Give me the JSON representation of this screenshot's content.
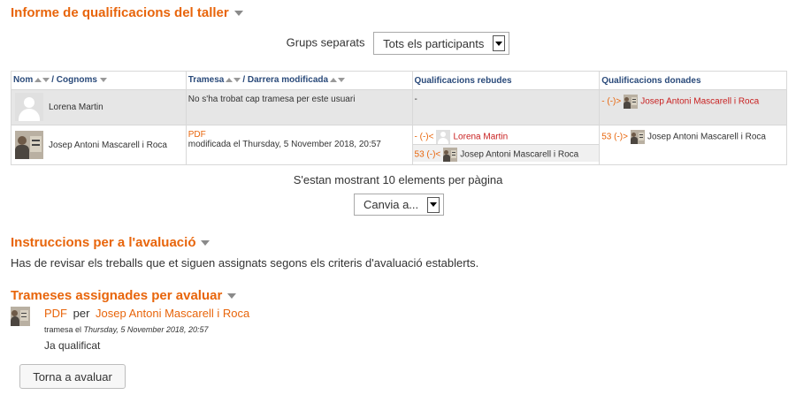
{
  "report": {
    "title": "Informe de qualificacions del taller"
  },
  "groups": {
    "label": "Grups separats",
    "selected": "Tots els participants"
  },
  "table": {
    "headers": {
      "name": "Nom",
      "surname": "/ Cognoms",
      "submission": "Tramesa",
      "last_modified": "/ Darrera modificada",
      "received": "Qualificacions rebudes",
      "given": "Qualificacions donades"
    },
    "rows": [
      {
        "user": "Lorena Martin",
        "avatar": "default-user-icon",
        "submission_text": "No s'ha trobat cap tramesa per este usuari",
        "received": "-",
        "given_grade": "- (-)>",
        "given_to": "Josep Antoni Mascarell i Roca"
      },
      {
        "user": "Josep Antoni Mascarell i Roca",
        "avatar": "user-photo-icon",
        "submission_link": "PDF",
        "submission_modified": "modificada el Thursday,   5 November 2018, 20:57",
        "received": [
          {
            "grade": "- (-)<",
            "from": "Lorena Martin"
          },
          {
            "grade": "53 (-)<",
            "from": "Josep Antoni Mascarell i Roca"
          }
        ],
        "given_grade": "53 (-)>",
        "given_to": "Josep Antoni Mascarell i Roca"
      }
    ]
  },
  "pagination": {
    "per_page_text": "S'estan mostrant 10 elements per pàgina",
    "change_select": "Canvia a..."
  },
  "instructions": {
    "title": "Instruccions per a l'avaluació",
    "text": "Has de revisar els treballs que et siguen assignats segons els criteris d'avaluació establerts."
  },
  "assigned": {
    "title": "Trameses assignades per avaluar",
    "submission_title": "PDF",
    "by": "per",
    "author": "Josep Antoni Mascarell i Roca",
    "meta_prefix": "tramesa el",
    "meta_date": "Thursday,  5 November 2018, 20:57",
    "status": "Ja qualificat",
    "back_button": "Torna a avaluar"
  },
  "colors": {
    "accent": "#e8650b",
    "link_red": "#c81e1e",
    "header_blue": "#2a4a7a"
  }
}
